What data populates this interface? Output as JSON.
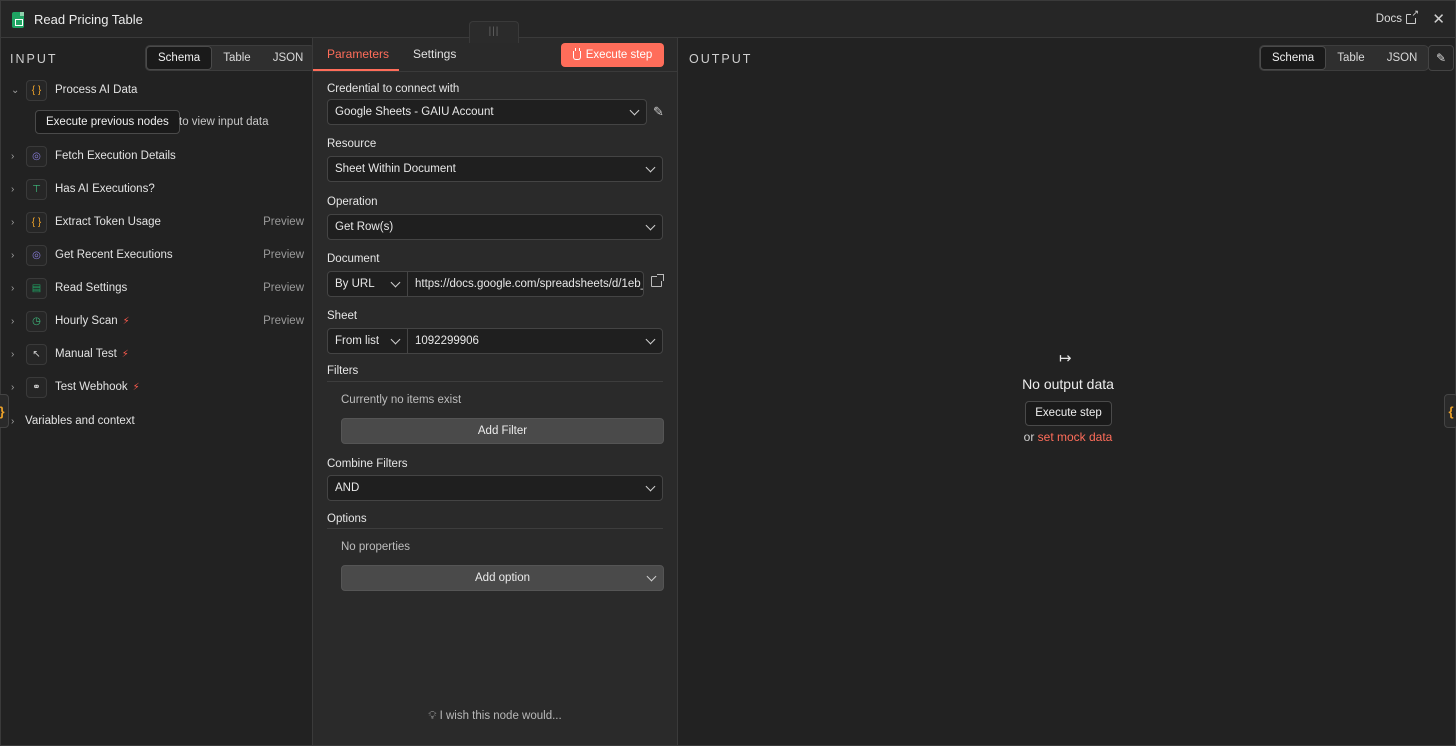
{
  "window": {
    "title": "Read Pricing Table",
    "docs_label": "Docs",
    "close_glyph": "✕",
    "drag_glyph": "|||"
  },
  "input": {
    "heading": "INPUT",
    "views": [
      "Schema",
      "Table",
      "JSON"
    ],
    "active_view": "Schema",
    "execute_previous_label": "Execute previous nodes",
    "execute_previous_tail": "to view input data",
    "nodes": [
      {
        "label": "Process AI Data",
        "icon": "braces-icon",
        "glyph": "{}",
        "color": "#f0a429",
        "expanded": true,
        "preview": "",
        "trigger": false
      },
      {
        "label": "Fetch Execution Details",
        "icon": "globe-icon",
        "glyph": "◎",
        "color": "#8a7fe0",
        "preview": "",
        "trigger": false
      },
      {
        "label": "Has AI Executions?",
        "icon": "signpost-icon",
        "glyph": "⊤",
        "color": "#3fbf7f",
        "preview": "",
        "trigger": false
      },
      {
        "label": "Extract Token Usage",
        "icon": "braces-icon",
        "glyph": "{}",
        "color": "#f0a429",
        "preview": "Preview",
        "trigger": false
      },
      {
        "label": "Get Recent Executions",
        "icon": "globe-icon",
        "glyph": "◎",
        "color": "#8a7fe0",
        "preview": "Preview",
        "trigger": false
      },
      {
        "label": "Read Settings",
        "icon": "google-sheets-icon",
        "glyph": "▤",
        "color": "#1fa463",
        "preview": "Preview",
        "trigger": false
      },
      {
        "label": "Hourly Scan",
        "icon": "clock-icon",
        "glyph": "◷",
        "color": "#3fbf7f",
        "preview": "Preview",
        "trigger": true
      },
      {
        "label": "Manual Test",
        "icon": "pointer-icon",
        "glyph": "↖",
        "color": "#cfcfcf",
        "preview": "",
        "trigger": true
      },
      {
        "label": "Test Webhook",
        "icon": "webhook-icon",
        "glyph": "⚭",
        "color": "#e0e0e0",
        "preview": "",
        "trigger": true
      }
    ],
    "variables_label": "Variables and context"
  },
  "params": {
    "tabs": [
      "Parameters",
      "Settings"
    ],
    "active_tab": "Parameters",
    "execute_step_label": "Execute step",
    "credential": {
      "label": "Credential to connect with",
      "value": "Google Sheets - GAIU Account"
    },
    "resource": {
      "label": "Resource",
      "value": "Sheet Within Document"
    },
    "operation": {
      "label": "Operation",
      "value": "Get Row(s)"
    },
    "document": {
      "label": "Document",
      "mode": "By URL",
      "value": "https://docs.google.com/spreadsheets/d/1eb_"
    },
    "sheet": {
      "label": "Sheet",
      "mode": "From list",
      "value": "1092299906"
    },
    "filters": {
      "label": "Filters",
      "empty_text": "Currently no items exist",
      "add_label": "Add Filter"
    },
    "combine_filters": {
      "label": "Combine Filters",
      "value": "AND"
    },
    "options": {
      "label": "Options",
      "empty_text": "No properties",
      "add_label": "Add option"
    },
    "wish_text": "I wish this node would..."
  },
  "output": {
    "heading": "OUTPUT",
    "views": [
      "Schema",
      "Table",
      "JSON"
    ],
    "active_view": "Schema",
    "empty_title": "No output data",
    "execute_label": "Execute step",
    "or_text": "or",
    "mock_link": "set mock data"
  },
  "colors": {
    "accent": "#ff6d5a",
    "trigger_bolt": "#ff5a4d",
    "panel_bg": "#222222",
    "params_bg": "#2a2a2a"
  }
}
